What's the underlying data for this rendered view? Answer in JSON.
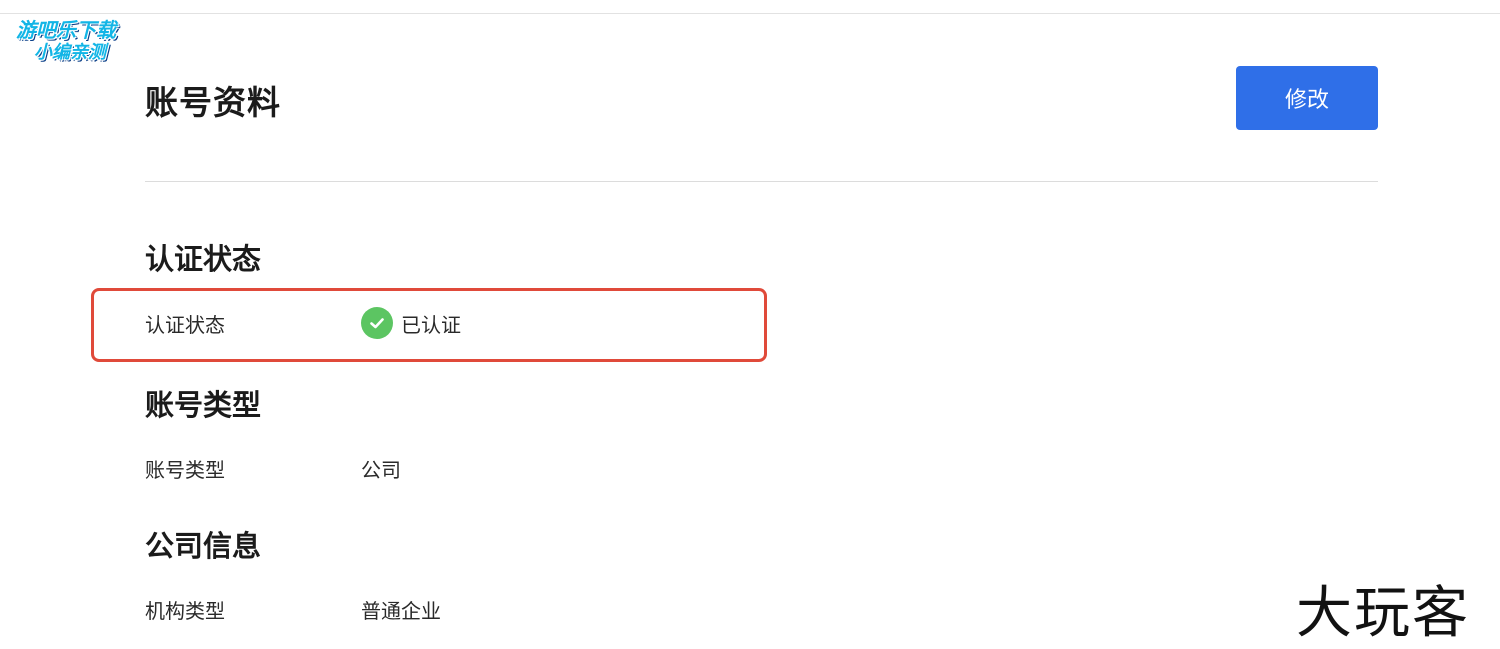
{
  "watermarks": {
    "top_line1": "游吧乐下载",
    "top_line2": "小编亲测",
    "bottom": "大玩客"
  },
  "header": {
    "title": "账号资料",
    "edit_button_label": "修改"
  },
  "sections": {
    "verification": {
      "title": "认证状态",
      "field_label": "认证状态",
      "field_value": "已认证"
    },
    "account_type": {
      "title": "账号类型",
      "field_label": "账号类型",
      "field_value": "公司"
    },
    "company_info": {
      "title": "公司信息",
      "field_label": "机构类型",
      "field_value": "普通企业"
    }
  },
  "colors": {
    "primary_button": "#2f6fe8",
    "verified_green": "#5cc562",
    "highlight_red": "#e04a3a"
  },
  "icons": {
    "verified": "check-circle-icon"
  }
}
